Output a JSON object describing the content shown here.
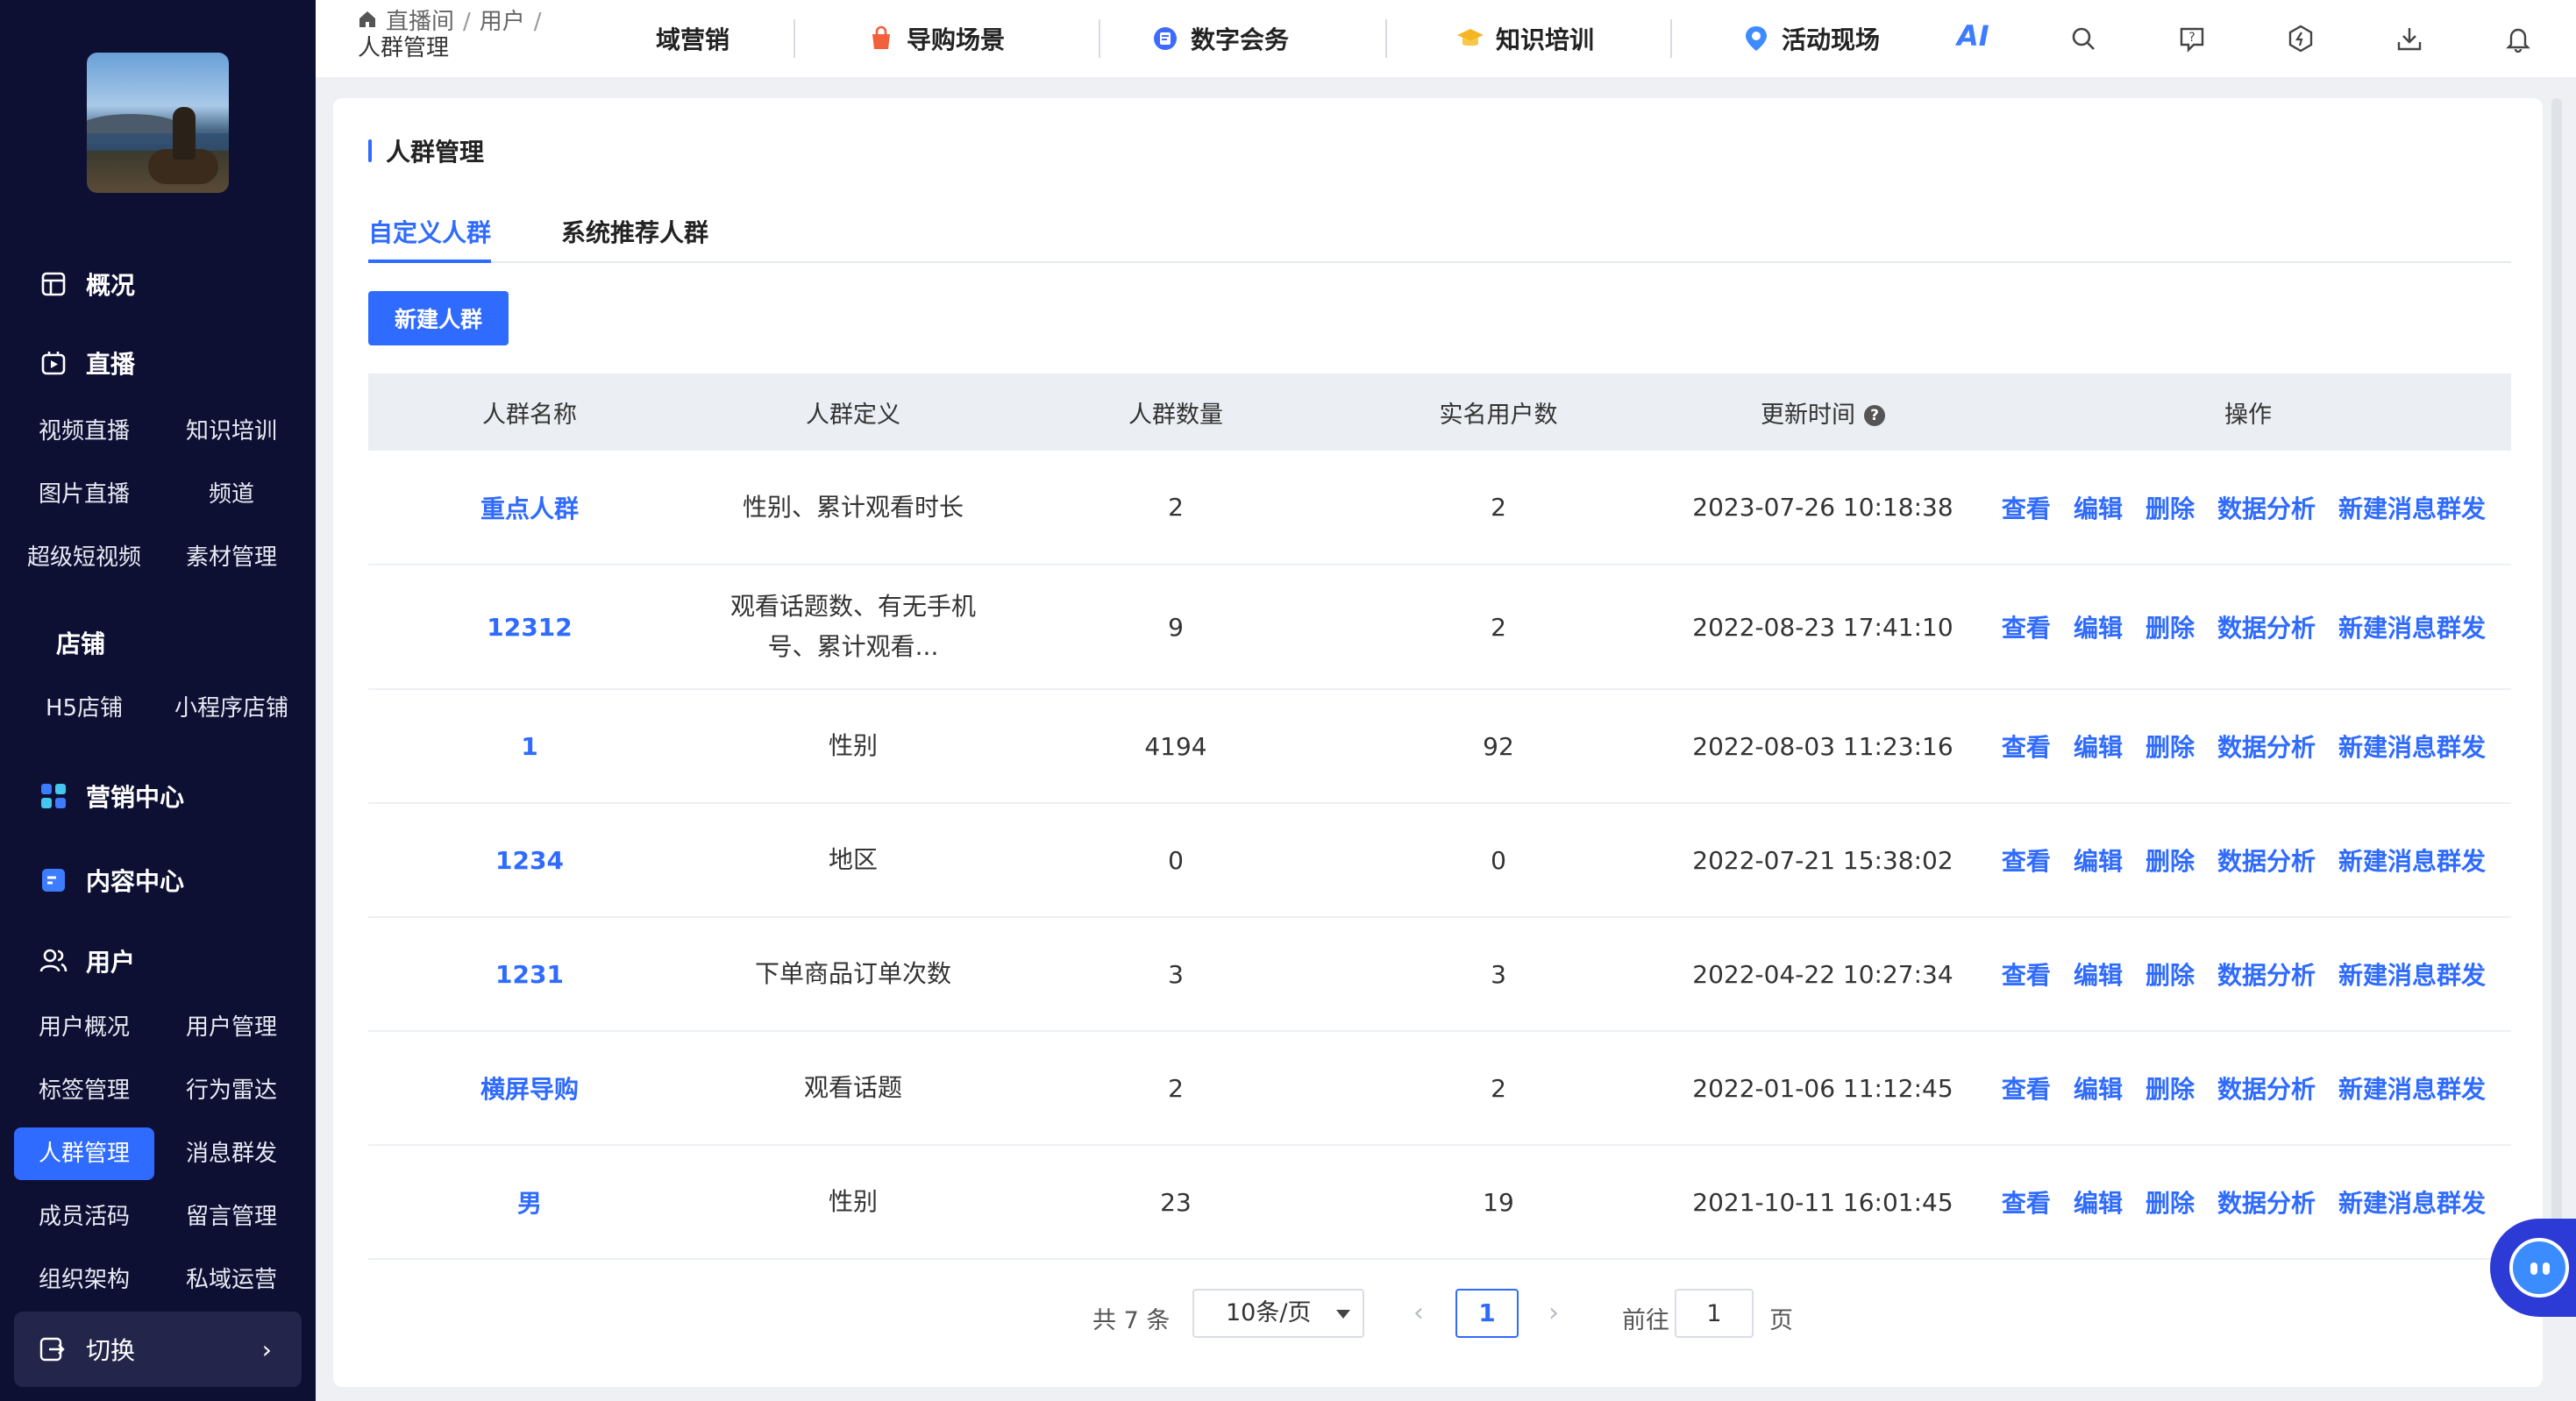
{
  "sidebar": {
    "nav": {
      "overview": "概况",
      "live": "直播",
      "store": "店铺",
      "marketing": "营销中心",
      "content": "内容中心",
      "user": "用户"
    },
    "live_items": [
      "视频直播",
      "知识培训",
      "图片直播",
      "频道",
      "超级短视频",
      "素材管理"
    ],
    "store_items": [
      "H5店铺",
      "小程序店铺"
    ],
    "user_items": [
      "用户概况",
      "用户管理",
      "标签管理",
      "行为雷达",
      "人群管理",
      "消息群发",
      "成员活码",
      "留言管理",
      "组织架构",
      "私域运营"
    ],
    "active_item": "人群管理",
    "switch_label": "切换"
  },
  "topbar": {
    "breadcrumb": [
      "直播间",
      "用户",
      "人群管理"
    ],
    "nav": [
      "域营销",
      "导购场景",
      "数字会务",
      "知识培训",
      "活动现场"
    ],
    "ai_label": "AI"
  },
  "page": {
    "title": "人群管理",
    "tabs": [
      "自定义人群",
      "系统推荐人群"
    ],
    "active_tab": "自定义人群",
    "new_button": "新建人群"
  },
  "table": {
    "headers": [
      "人群名称",
      "人群定义",
      "人群数量",
      "实名用户数",
      "更新时间",
      "操作"
    ],
    "actions": [
      "查看",
      "编辑",
      "删除",
      "数据分析",
      "新建消息群发"
    ],
    "rows": [
      {
        "name": "重点人群",
        "definition": "性别、累计观看时长",
        "count": "2",
        "verified": "2",
        "updated": "2023-07-26 10:18:38"
      },
      {
        "name": "12312",
        "definition": "观看话题数、有无手机号、累计观看...",
        "count": "9",
        "verified": "2",
        "updated": "2022-08-23 17:41:10"
      },
      {
        "name": "1",
        "definition": "性别",
        "count": "4194",
        "verified": "92",
        "updated": "2022-08-03 11:23:16"
      },
      {
        "name": "1234",
        "definition": "地区",
        "count": "0",
        "verified": "0",
        "updated": "2022-07-21 15:38:02"
      },
      {
        "name": "1231",
        "definition": "下单商品订单次数",
        "count": "3",
        "verified": "3",
        "updated": "2022-04-22 10:27:34"
      },
      {
        "name": "横屏导购",
        "definition": "观看话题",
        "count": "2",
        "verified": "2",
        "updated": "2022-01-06 11:12:45"
      },
      {
        "name": "男",
        "definition": "性别",
        "count": "23",
        "verified": "19",
        "updated": "2021-10-11 16:01:45"
      }
    ]
  },
  "pagination": {
    "total": "共 7 条",
    "page_size": "10条/页",
    "current_page": "1",
    "goto_label": "前往",
    "goto_value": "1",
    "page_unit": "页"
  },
  "colors": {
    "accent": "#2f6bff",
    "sidebar_bg": "#0d1033",
    "header_row_bg": "#ebeef3"
  }
}
